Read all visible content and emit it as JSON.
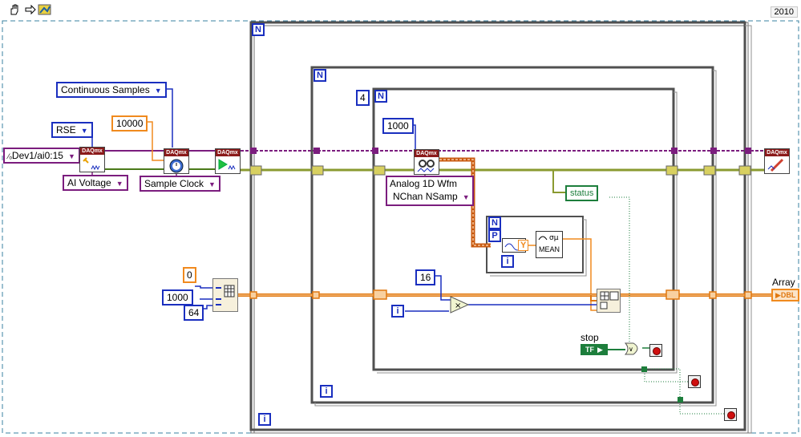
{
  "toolbar": {
    "run_icon": "hand-icon",
    "step_icon": "arrow-icon",
    "highlight_icon": "probe-icon",
    "version": "2010"
  },
  "constants": {
    "channel": "Dev1/ai0:15",
    "terminal_config": "RSE",
    "sample_mode": "Continuous Samples",
    "rate": "10000",
    "measurement": "AI Voltage",
    "timing_type": "Sample Clock",
    "loop_count": "4",
    "samples": "1000",
    "read_type_line1": "Analog 1D Wfm",
    "read_type_line2": "NChan NSamp",
    "init_value": "0",
    "rows": "1000",
    "cols": "64",
    "multiplier": "16",
    "status": "status",
    "stop_label": "stop",
    "stop_const": "TF",
    "array_label": "Array",
    "array_type": "DBL"
  },
  "nodes": {
    "daqmx": "DAQmx",
    "stats_y": "Y",
    "stats_mean": "MEAN",
    "n_label": "N",
    "p_label": "P",
    "i_label": "i"
  },
  "colors": {
    "wire_purple": "#7b1d7e",
    "wire_green": "#4a7a1a",
    "wire_orange": "#f08a1e",
    "wire_blue": "#1a2fbf",
    "frame": "#606060"
  }
}
